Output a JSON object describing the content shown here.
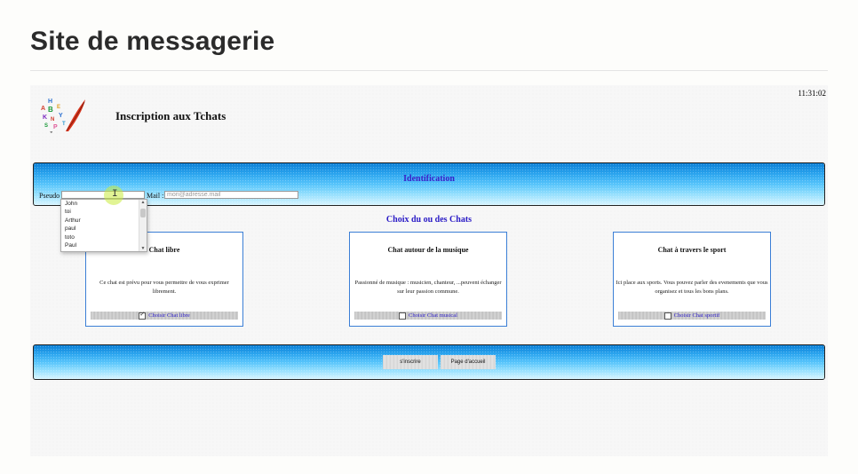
{
  "page": {
    "heading": "Site de messagerie"
  },
  "frame": {
    "clock": "11:31:02",
    "title": "Inscription aux Tchats"
  },
  "identification": {
    "title": "Identification",
    "pseudo_label": "Pseudo :",
    "pseudo_value": "",
    "mail_label": "Mail :",
    "mail_placeholder": "mon@adresse.mail",
    "suggestions": [
      "John",
      "toi",
      "Arthur",
      "paul",
      "toto",
      "Paul"
    ]
  },
  "choix": {
    "title": "Choix du ou des Chats",
    "cards": [
      {
        "title": "Chat libre",
        "description": "Ce chat est prévu pour vous permettre de vous exprimer librement.",
        "checkbox_label": "Choisir Chat libre",
        "checked": true
      },
      {
        "title": "Chat autour de la musique",
        "description": "Passionné de musique : musicien, chanteur, ...peuvent échanger sur leur passion commune.",
        "checkbox_label": "Choisir Chat musical",
        "checked": false
      },
      {
        "title": "Chat à travers le sport",
        "description": "Ici place aux sports. Vous pouvez parler des evenements que vous organisez et tous les bons plans.",
        "checkbox_label": "Choisir Chat sportif",
        "checked": false
      }
    ]
  },
  "actions": {
    "signup_label": "s'inscrire",
    "home_label": "Page d'accueil"
  },
  "colors": {
    "band_top": "#0a7fd6",
    "band_bottom": "#d8f5ff",
    "accent_text": "#2a1bc6",
    "card_border": "#3c7fd6"
  }
}
